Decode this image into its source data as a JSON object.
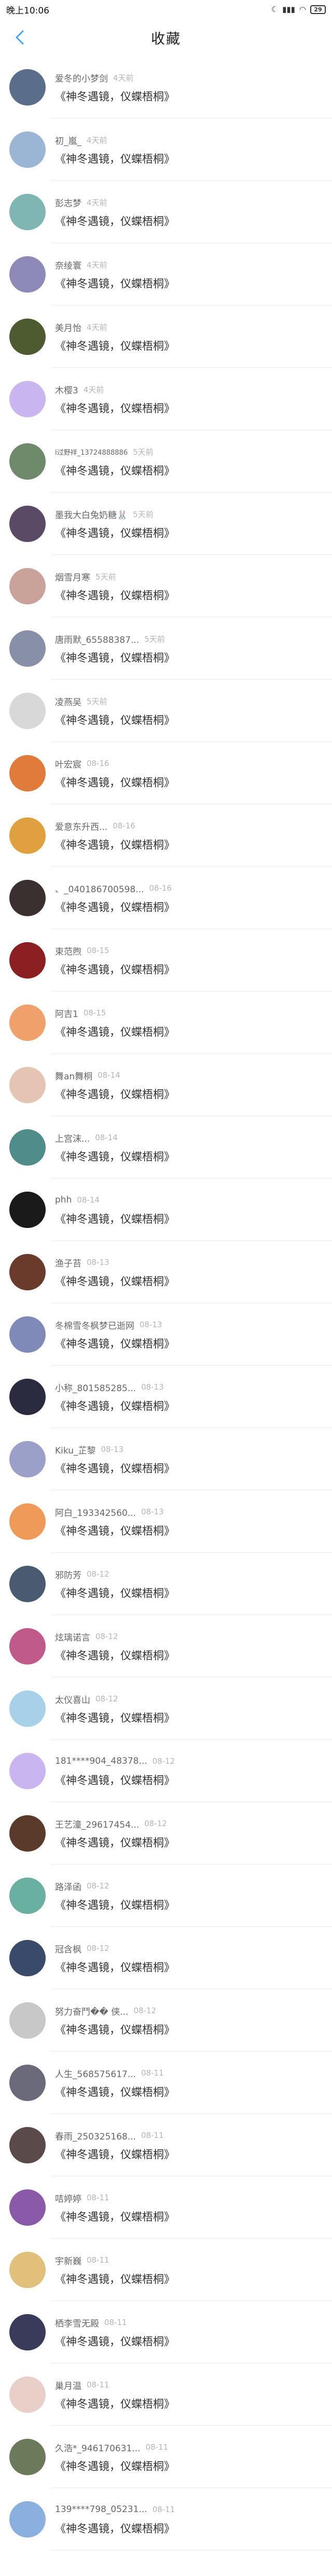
{
  "status_bar": {
    "time": "晚上10:06",
    "battery": "29"
  },
  "header": {
    "title": "收藏"
  },
  "colors": {
    "divider": "#eeeeee",
    "back_arrow": "#3da9f5"
  },
  "items": [
    {
      "name": "爱冬的小梦剑",
      "time": "4天前",
      "title": "《神冬遇镜，仪蝶梧桐》",
      "avatar": "#5a6e8c"
    },
    {
      "name": "初_嵐_",
      "time": "4天前",
      "title": "《神冬遇镜，仪蝶梧桐》",
      "avatar": "#9bb6d4"
    },
    {
      "name": "彭志梦",
      "time": "4天前",
      "title": "《神冬遇镜，仪蝶梧桐》",
      "avatar": "#7fb5b3"
    },
    {
      "name": "奈绫寰",
      "time": "4天前",
      "title": "《神冬遇镜，仪蝶梧桐》",
      "avatar": "#8e8ab8"
    },
    {
      "name": "美月怡",
      "time": "4天前",
      "title": "《神冬遇镜，仪蝶梧桐》",
      "avatar": "#4e5a2f"
    },
    {
      "name": "木樱3",
      "time": "4天前",
      "title": "《神冬遇镜，仪蝶梧桐》",
      "avatar": "#c9b6f0"
    },
    {
      "name": "l过野祥_13724888886",
      "time": "5天前",
      "title": "《神冬遇镜，仪蝶梧桐》",
      "avatar": "#6f8a6a",
      "small": true
    },
    {
      "name": "墨我大白兔奶糖🐰",
      "time": "5天前",
      "title": "《神冬遇镜，仪蝶梧桐》",
      "avatar": "#5b4a66"
    },
    {
      "name": "烟雪月寒",
      "time": "5天前",
      "title": "《神冬遇镜，仪蝶梧桐》",
      "avatar": "#c9a39a"
    },
    {
      "name": "唐雨默_65588387...",
      "time": "5天前",
      "title": "《神冬遇镜，仪蝶梧桐》",
      "avatar": "#8890a8"
    },
    {
      "name": "凌燕吴",
      "time": "5天前",
      "title": "《神冬遇镜，仪蝶梧桐》",
      "avatar": "#d8d8d8"
    },
    {
      "name": "叶宏宸",
      "time": "08-16",
      "title": "《神冬遇镜，仪蝶梧桐》",
      "avatar": "#e07b3c"
    },
    {
      "name": "爱意东升西...",
      "time": "08-16",
      "title": "《神冬遇镜，仪蝶梧桐》",
      "avatar": "#e0a040"
    },
    {
      "name": "、_040186700598...",
      "time": "08-16",
      "title": "《神冬遇镜，仪蝶梧桐》",
      "avatar": "#3a3030"
    },
    {
      "name": "束范煦",
      "time": "08-15",
      "title": "《神冬遇镜，仪蝶梧桐》",
      "avatar": "#8c1f22"
    },
    {
      "name": "阿吉1",
      "time": "08-15",
      "title": "《神冬遇镜，仪蝶梧桐》",
      "avatar": "#f0a06a"
    },
    {
      "name": "舞an舞桐",
      "time": "08-14",
      "title": "《神冬遇镜，仪蝶梧桐》",
      "avatar": "#e6c4b4"
    },
    {
      "name": "上宫沫...",
      "time": "08-14",
      "title": "《神冬遇镜，仪蝶梧桐》",
      "avatar": "#4f8c8a"
    },
    {
      "name": "phh",
      "time": "08-14",
      "title": "《神冬遇镜，仪蝶梧桐》",
      "avatar": "#1a1a1a"
    },
    {
      "name": "渔子苔",
      "time": "08-13",
      "title": "《神冬遇镜，仪蝶梧桐》",
      "avatar": "#6a3a2a"
    },
    {
      "name": "冬棉雪冬枫梦已逝网",
      "time": "08-13",
      "title": "《神冬遇镜，仪蝶梧桐》",
      "avatar": "#7f8ab8"
    },
    {
      "name": "小称_801585285...",
      "time": "08-13",
      "title": "《神冬遇镜，仪蝶梧桐》",
      "avatar": "#2b2b40"
    },
    {
      "name": "Kiku_芷黎",
      "time": "08-13",
      "title": "《神冬遇镜，仪蝶梧桐》",
      "avatar": "#9aa0c8"
    },
    {
      "name": "阿白_193342560...",
      "time": "08-13",
      "title": "《神冬遇镜，仪蝶梧桐》",
      "avatar": "#f09a5a"
    },
    {
      "name": "邪防芳",
      "time": "08-12",
      "title": "《神冬遇镜，仪蝶梧桐》",
      "avatar": "#4a5a70"
    },
    {
      "name": "炫璃诺言",
      "time": "08-12",
      "title": "《神冬遇镜，仪蝶梧桐》",
      "avatar": "#c05a8a"
    },
    {
      "name": "太仪喜山",
      "time": "08-12",
      "title": "《神冬遇镜，仪蝶梧桐》",
      "avatar": "#a8d0e8"
    },
    {
      "name": "181****904_48378...",
      "time": "08-12",
      "title": "《神冬遇镜，仪蝶梧桐》",
      "avatar": "#c9b6f0"
    },
    {
      "name": "王艺潼_29617454...",
      "time": "08-12",
      "title": "《神冬遇镜，仪蝶梧桐》",
      "avatar": "#5a3a2a"
    },
    {
      "name": "路泽函",
      "time": "08-12",
      "title": "《神冬遇镜，仪蝶梧桐》",
      "avatar": "#6ab0a0"
    },
    {
      "name": "冠含枫",
      "time": "08-12",
      "title": "《神冬遇镜，仪蝶梧桐》",
      "avatar": "#3a4a6a"
    },
    {
      "name": "努力奋鬥�� 侠...",
      "time": "08-12",
      "title": "《神冬遇镜，仪蝶梧桐》",
      "avatar": "#c8c8c8"
    },
    {
      "name": "人生_568575617...",
      "time": "08-11",
      "title": "《神冬遇镜，仪蝶梧桐》",
      "avatar": "#6a6a7a"
    },
    {
      "name": "春雨_250325168...",
      "time": "08-11",
      "title": "《神冬遇镜，仪蝶梧桐》",
      "avatar": "#5a4a4a"
    },
    {
      "name": "咭婷婷",
      "time": "08-11",
      "title": "《神冬遇镜，仪蝶梧桐》",
      "avatar": "#8a5aa8"
    },
    {
      "name": "宇新巍",
      "time": "08-11",
      "title": "《神冬遇镜，仪蝶梧桐》",
      "avatar": "#e0c07a"
    },
    {
      "name": "栖李雪无殿",
      "time": "08-11",
      "title": "《神冬遇镜，仪蝶梧桐》",
      "avatar": "#3a3a5a"
    },
    {
      "name": "巢月温",
      "time": "08-11",
      "title": "《神冬遇镜，仪蝶梧桐》",
      "avatar": "#e8d0c8"
    },
    {
      "name": "久浩*_946170631...",
      "time": "08-11",
      "title": "《神冬遇镜，仪蝶梧桐》",
      "avatar": "#6a7a5a"
    },
    {
      "name": "139****798_05231...",
      "time": "08-11",
      "title": "《神冬遇镜，仪蝶梧桐》",
      "avatar": "#8ab0e0"
    }
  ]
}
